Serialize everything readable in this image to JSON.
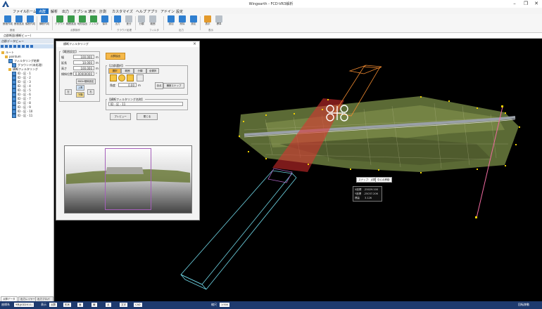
{
  "window": {
    "title": "Wingearth - FCD-VR3解析",
    "minimize": "–",
    "maximize": "❐",
    "close": "✕"
  },
  "menu": [
    "ファイル",
    "ホーム",
    "点群",
    "解析",
    "出力",
    "オプション",
    "表示",
    "計測",
    "カスタマイズ",
    "ヘルプ",
    "アプリ",
    "アドイン",
    "設定"
  ],
  "ribbon": {
    "buttons": [
      "断面作成",
      "断面追加",
      "縦断作成",
      "横断作成",
      "クラウド",
      "範囲追加",
      "地形抽出",
      "フィルタ",
      "保存",
      "出力",
      "差分",
      "分類",
      "範囲",
      "追加",
      "削除",
      "設定",
      "表示",
      "標準"
    ],
    "groups": [
      "断面",
      "点群操作",
      "クラウド処理",
      "フィルタ",
      "出力",
      "表示"
    ]
  },
  "breadcrumb": "点群断面(横断ビュー)",
  "left_panel": {
    "title": "点群データビュー",
    "tree": [
      {
        "label": "ルート",
        "indent": 0,
        "icon": "folder"
      },
      {
        "label": "pointum",
        "indent": 1,
        "icon": "folder"
      },
      {
        "label": "フィルタリング結果",
        "indent": 2,
        "icon": "model"
      },
      {
        "label": "グラウンド(未処理)",
        "indent": 3,
        "icon": "model"
      },
      {
        "label": "横断フィルタリング",
        "indent": 2,
        "icon": "folder"
      },
      {
        "label": "ID - 区 - 1",
        "indent": 3,
        "icon": "model"
      },
      {
        "label": "ID - 区 - 2",
        "indent": 3,
        "icon": "model"
      },
      {
        "label": "ID - 区 - 3",
        "indent": 3,
        "icon": "model"
      },
      {
        "label": "ID - 区 - 4",
        "indent": 3,
        "icon": "model"
      },
      {
        "label": "ID - 区 - 5",
        "indent": 3,
        "icon": "model"
      },
      {
        "label": "ID - 区 - 6",
        "indent": 3,
        "icon": "model"
      },
      {
        "label": "ID - 区 - 7",
        "indent": 3,
        "icon": "model"
      },
      {
        "label": "ID - 区 - 8",
        "indent": 3,
        "icon": "model"
      },
      {
        "label": "ID - 区 - 9",
        "indent": 3,
        "icon": "model"
      },
      {
        "label": "ID - 区 - 10",
        "indent": 3,
        "icon": "model"
      },
      {
        "label": "ID - 区 - 11",
        "indent": 3,
        "icon": "model"
      }
    ],
    "tabs": [
      "点群データ",
      "出力レイヤー",
      "出力プロパティ"
    ]
  },
  "dialog": {
    "title": "横断フィルタリング",
    "section_params": "【範囲設定】",
    "fields": [
      {
        "label": "幅",
        "value": "100.000",
        "unit": "m"
      },
      {
        "label": "延長",
        "value": "10.000",
        "unit": "m"
      },
      {
        "label": "高さ",
        "value": "100.000",
        "unit": "m"
      },
      {
        "label": "傾斜位置",
        "value": "0.00000000",
        "unit": "°"
      }
    ],
    "btn_orientation": "MiDir傾斜設定",
    "btn_left": "左",
    "btn_right": "右",
    "btn_up": "上昇",
    "btn_down": "下降",
    "btn_exec": "点群抽出",
    "section_select": "【点群選択】",
    "select_tabs": [
      "選択",
      "範囲",
      "分類",
      "全選択"
    ],
    "degree_label": "角度",
    "degree_value": "0.00",
    "degree_unit": "m",
    "btn_snap": "横断スナップ",
    "btn_target": "全点",
    "section_name": "【横断フィルタリング名称】",
    "name_value": "ID - 区 - 11",
    "btn_preview": "プレビュー",
    "btn_cancel": "閉じる"
  },
  "viewport": {
    "btn_snap": "スナップ：点群",
    "btn_center": "中心点移動",
    "readout": [
      "X座標　-25029.100",
      "Y座標　-25037.206",
      "標高　　3.126"
    ]
  },
  "status": {
    "coord_label": "座標系",
    "coord_value": "9系(JGD2011)",
    "display_label": "表示",
    "fields": [
      "点群",
      "形状",
      "面",
      "線",
      "点",
      "文字",
      "CAD"
    ],
    "scale_label": "縮尺",
    "scale_value": "1:500",
    "right_text": "回転移動"
  },
  "colors": {
    "accent": "#1d6fc4",
    "statusbar": "#1e3a6e",
    "section_red": "#e03030",
    "box_orange": "#f08a30",
    "box_cyan": "#6fd6e6",
    "box_purple": "#a560ba",
    "line_pink": "#f06aa0"
  }
}
